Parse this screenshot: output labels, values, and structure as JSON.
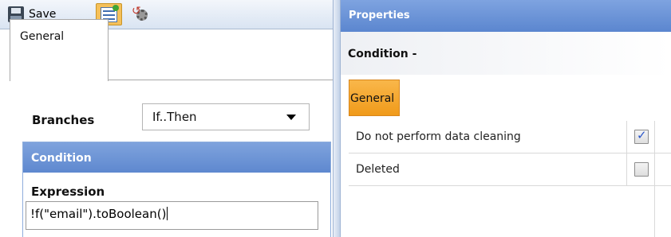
{
  "toolbar": {
    "save_label": "Save",
    "icons": [
      "floppy-disk-icon",
      "properties-icon",
      "refresh-gear-icon"
    ]
  },
  "left": {
    "tab_label": "General",
    "branches": {
      "label": "Branches",
      "value": "If..Then"
    },
    "condition": {
      "header": "Condition",
      "expression_label": "Expression",
      "expression_value": "!f(\"email\").toBoolean()"
    }
  },
  "right": {
    "header": "Properties",
    "title": "Condition -",
    "tab_label": "General",
    "properties": [
      {
        "name": "Do not perform data cleaning",
        "checked": true
      },
      {
        "name": "Deleted",
        "checked": false
      }
    ]
  },
  "colors": {
    "panel_header_blue": "#6b93d6",
    "active_tab_orange": "#f2a530",
    "toolbar_active": "#f5c05a"
  }
}
